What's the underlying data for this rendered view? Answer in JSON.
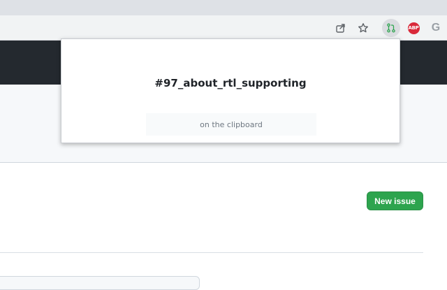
{
  "browser": {
    "toolbar": {
      "icons": [
        "share-icon",
        "bookmark-star-icon",
        "pull-request-extension-icon",
        "adblock-plus-icon",
        "google-icon"
      ],
      "adblock_label": "ABP",
      "google_label": "G"
    }
  },
  "popup": {
    "branch_name": "#97_about_rtl_supporting",
    "status": "on the clipboard"
  },
  "page": {
    "new_issue_label": "New issue"
  },
  "colors": {
    "header_bg": "#24292f",
    "subhead_bg": "#f6f8fa",
    "primary_button": "#2da44e",
    "adblock_red": "#d9293a"
  }
}
